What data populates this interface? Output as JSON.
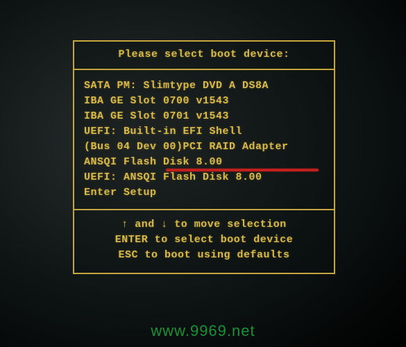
{
  "title": "Please select boot device:",
  "bootItems": [
    "SATA PM: Slimtype DVD A  DS8A",
    "IBA GE Slot 0700 v1543",
    "IBA GE Slot 0701 v1543",
    "UEFI: Built-in EFI Shell",
    "(Bus 04 Dev 00)PCI RAID Adapter",
    "ANSQI Flash Disk 8.00",
    "UEFI: ANSQI Flash Disk 8.00",
    "Enter Setup"
  ],
  "help": {
    "arrowUp": "↑",
    "arrowDown": "↓",
    "line1_mid": " and ",
    "line1_end": " to move selection",
    "line2": "ENTER to select boot device",
    "line3": "ESC to boot using defaults"
  },
  "watermark": "www.9969.net"
}
